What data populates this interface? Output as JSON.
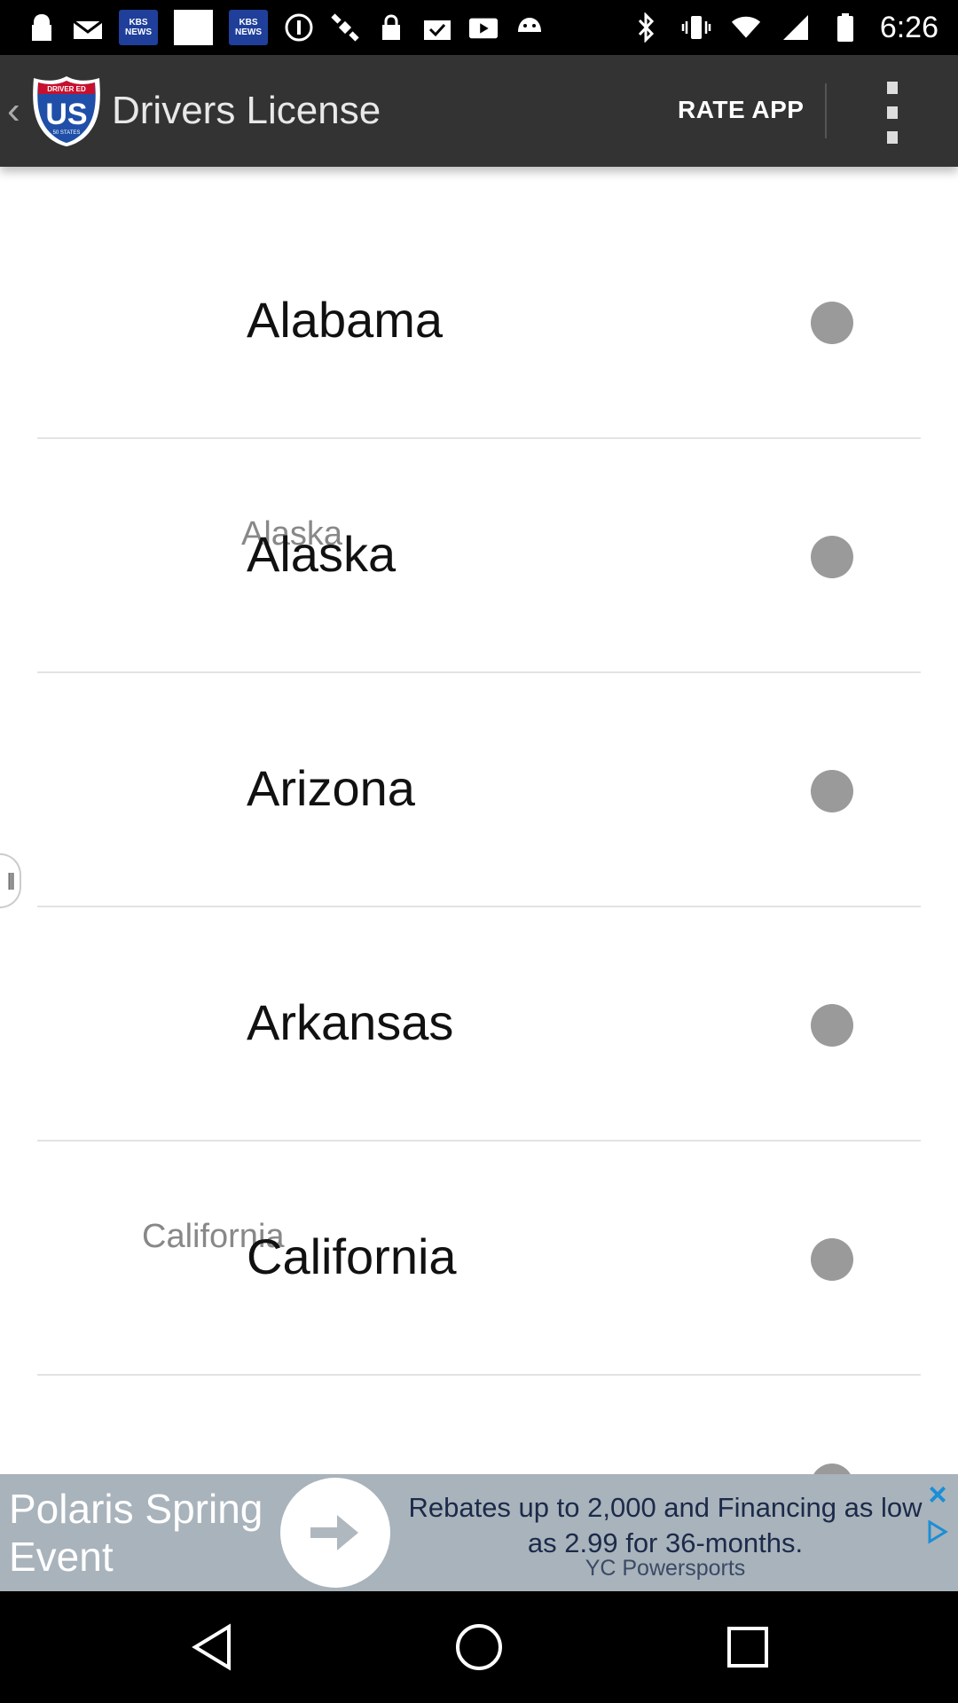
{
  "status_bar": {
    "time": "6:26",
    "kbs_label": "KBS",
    "kbs_sub": "NEWS",
    "icons": [
      "lock-icon",
      "mail-icon",
      "kbs-news-icon",
      "white-square-icon",
      "kbs-news-icon",
      "alert-icon",
      "satellite-icon",
      "lock-icon",
      "clipboard-icon",
      "play-icon",
      "android-icon",
      "bluetooth-icon",
      "vibrate-icon",
      "wifi-icon",
      "signal-icon",
      "battery-icon"
    ]
  },
  "app_bar": {
    "logo_top": "DRIVER ED",
    "logo_main": "US",
    "logo_bottom": "50 STATES",
    "title": "Drivers License",
    "rate_app": "RATE APP"
  },
  "states": [
    {
      "name": "Alabama"
    },
    {
      "name": "Alaska",
      "ghost": "Alaska"
    },
    {
      "name": "Arizona"
    },
    {
      "name": "Arkansas"
    },
    {
      "name": "California",
      "ghost": "California"
    }
  ],
  "ad": {
    "headline": "Polaris Spring Event",
    "text": "Rebates up to 2,000 and Financing as low as 2.99 for 36-months.",
    "brand": "YC Powersports"
  },
  "colors": {
    "app_bar": "#333333",
    "radio": "#9a9a9a",
    "ad_bg": "#a9b3bb",
    "logo_blue": "#1f4fa8",
    "logo_red": "#c8102e"
  }
}
